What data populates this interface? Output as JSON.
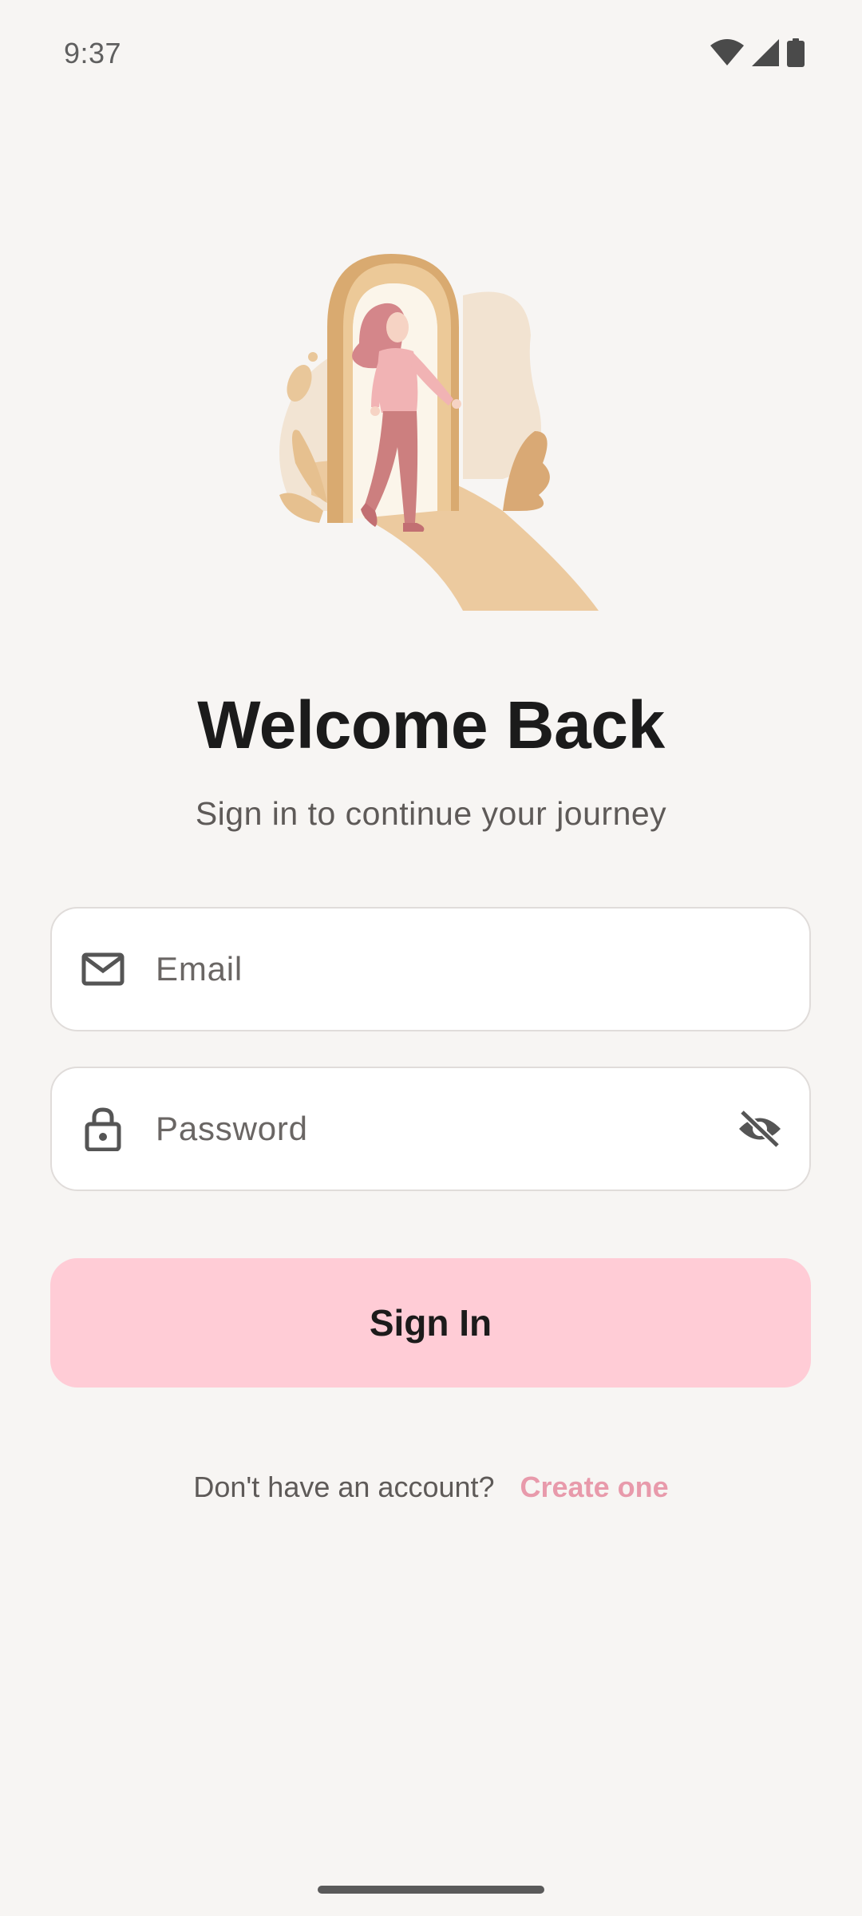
{
  "status_bar": {
    "time": "9:37",
    "icons": [
      "wifi-icon",
      "signal-icon",
      "battery-icon"
    ]
  },
  "illustration": {
    "name": "woman-walking-through-arch"
  },
  "header": {
    "title": "Welcome Back",
    "subtitle": "Sign in to continue your journey"
  },
  "form": {
    "email": {
      "placeholder": "Email",
      "value": "",
      "icon": "mail-icon"
    },
    "password": {
      "placeholder": "Password",
      "value": "",
      "icon": "lock-icon",
      "toggle_icon": "eye-off-icon"
    },
    "submit_label": "Sign In"
  },
  "footer": {
    "prompt": "Don't have an account?",
    "link": "Create one"
  },
  "colors": {
    "background": "#f7f5f3",
    "button": "#ffccd6",
    "link": "#e89aab",
    "accent_tan": "#e9c9a0"
  }
}
